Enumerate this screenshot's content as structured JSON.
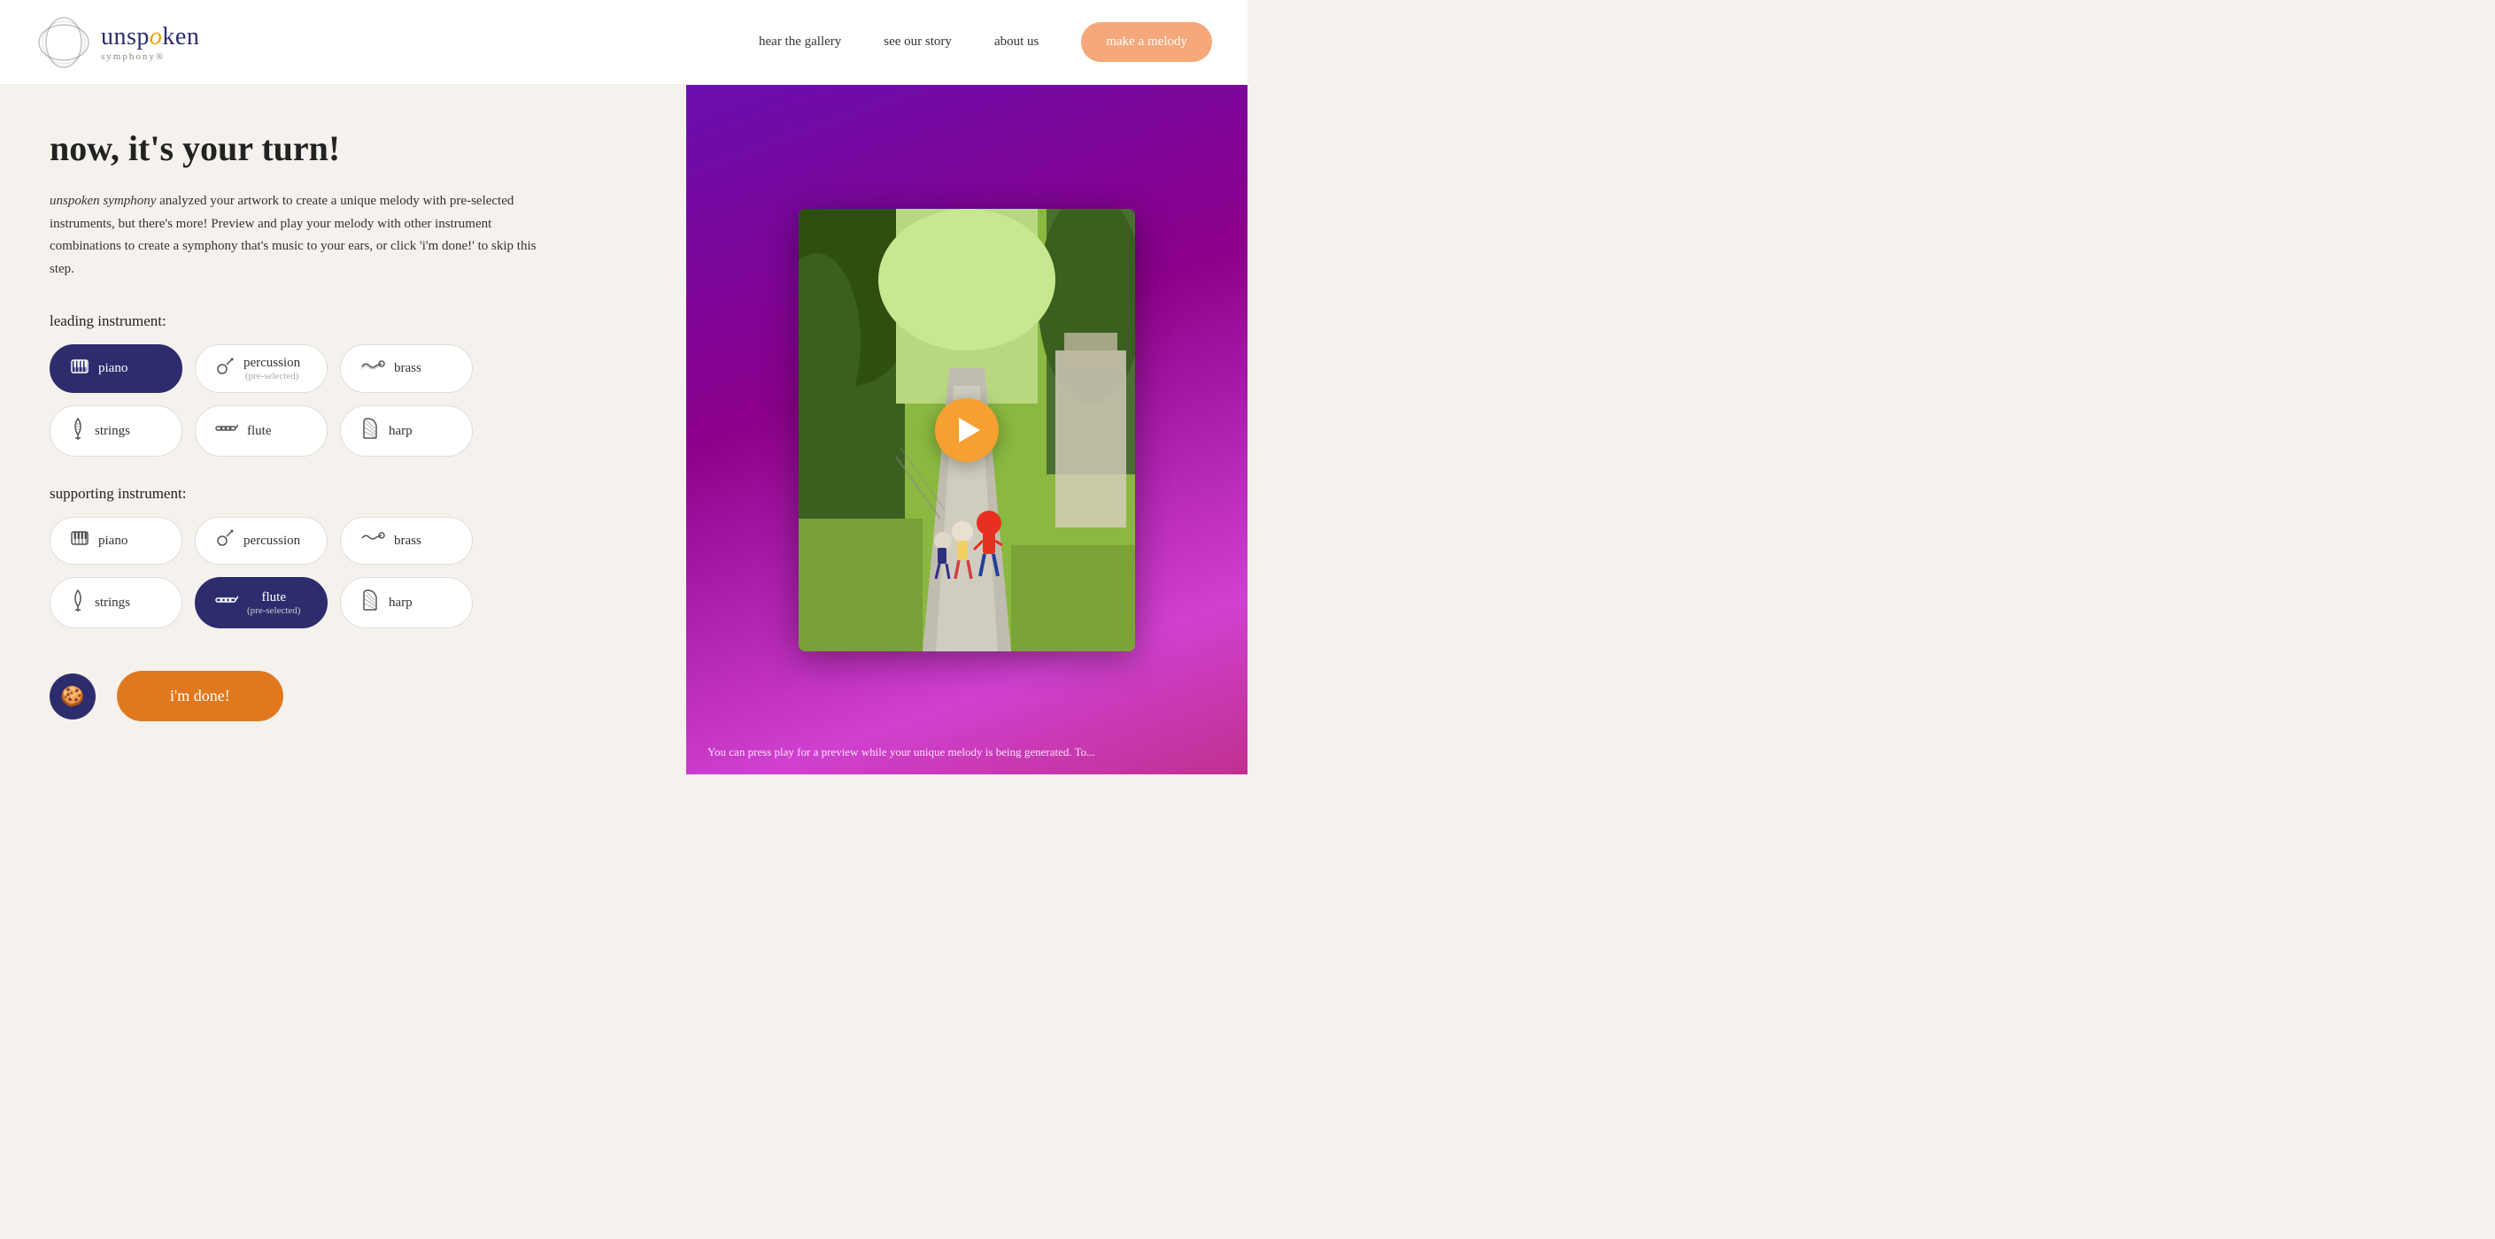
{
  "header": {
    "logo_title": "unspoken",
    "logo_o_char": "o",
    "logo_subtitle": "symphony®",
    "nav": {
      "hear_gallery": "hear the gallery",
      "see_story": "see our story",
      "about_us": "about us",
      "make_melody": "make a melody"
    }
  },
  "main": {
    "page_title": "now, it's your turn!",
    "description_italic": "unspoken symphony",
    "description_rest": " analyzed your artwork to create a unique melody with pre-selected instruments, but there's more! Preview and play your melody with other instrument combinations to create a symphony that's music to your ears, or click 'i'm done!' to skip this step.",
    "leading_label": "leading instrument:",
    "supporting_label": "supporting instrument:",
    "leading_instruments": [
      {
        "id": "piano-lead",
        "label": "piano",
        "sublabel": "",
        "active": true,
        "icon": "piano"
      },
      {
        "id": "percussion-lead",
        "label": "percussion",
        "sublabel": "(pre-selected)",
        "active": false,
        "icon": "percussion"
      },
      {
        "id": "brass-lead",
        "label": "brass",
        "sublabel": "",
        "active": false,
        "icon": "brass"
      },
      {
        "id": "strings-lead",
        "label": "strings",
        "sublabel": "",
        "active": false,
        "icon": "strings"
      },
      {
        "id": "flute-lead",
        "label": "flute",
        "sublabel": "",
        "active": false,
        "icon": "flute"
      },
      {
        "id": "harp-lead",
        "label": "harp",
        "sublabel": "",
        "active": false,
        "icon": "harp"
      }
    ],
    "supporting_instruments": [
      {
        "id": "piano-sup",
        "label": "piano",
        "sublabel": "",
        "active": false,
        "icon": "piano"
      },
      {
        "id": "percussion-sup",
        "label": "percussion",
        "sublabel": "",
        "active": false,
        "icon": "percussion"
      },
      {
        "id": "brass-sup",
        "label": "brass",
        "sublabel": "",
        "active": false,
        "icon": "brass"
      },
      {
        "id": "strings-sup",
        "label": "strings",
        "sublabel": "",
        "active": false,
        "icon": "strings"
      },
      {
        "id": "flute-sup",
        "label": "flute",
        "sublabel": "(pre-selected)",
        "active": true,
        "icon": "flute"
      },
      {
        "id": "harp-sup",
        "label": "harp",
        "sublabel": "",
        "active": false,
        "icon": "harp"
      }
    ],
    "done_button": "i'm done!",
    "right_bottom_text": "You can press play for a preview while your unique melody is being generated. To..."
  },
  "icons": {
    "piano": "▦",
    "percussion": "🥁",
    "brass": "🎺",
    "strings": "🎻",
    "flute": "🪈",
    "harp": "𝄞",
    "cookie": "🍪"
  }
}
